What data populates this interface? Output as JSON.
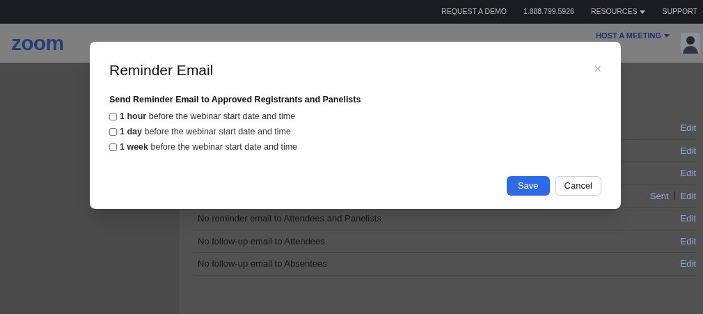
{
  "top_bar": {
    "links": [
      {
        "label": "REQUEST A DEMO",
        "dropdown": false
      },
      {
        "label": "1.888.799.5926",
        "dropdown": false
      },
      {
        "label": "RESOURCES",
        "dropdown": true
      },
      {
        "label": "SUPPORT",
        "dropdown": false
      }
    ]
  },
  "nav": {
    "logo": "zoom",
    "links": [
      {
        "label": "HOST A MEETING",
        "dropdown": true
      }
    ]
  },
  "email_rows": [
    {
      "action": "Edit"
    },
    {
      "action": "Edit"
    },
    {
      "action": "Edit"
    },
    {
      "status": "Sent",
      "action": "Edit"
    },
    {
      "text": "No reminder email to Attendees and Panelists",
      "action": "Edit"
    },
    {
      "text": "No follow-up email to Attendees",
      "action": "Edit"
    },
    {
      "text": "No follow-up email to Absentees",
      "action": "Edit"
    }
  ],
  "dialog": {
    "title": "Reminder Email",
    "close": "×",
    "heading": "Send Reminder Email to Approved Registrants and Panelists",
    "options": [
      {
        "label": "**1 hour** before the webinar start date and time",
        "checked": false
      },
      {
        "label": "**1 day** before the webinar start date and time",
        "checked": false
      },
      {
        "label": "**1 week** before the webinar start date and time",
        "checked": false
      }
    ],
    "buttons": [
      {
        "label": "Save",
        "kind": "primary"
      },
      {
        "label": "Cancel",
        "kind": "secondary"
      }
    ]
  }
}
